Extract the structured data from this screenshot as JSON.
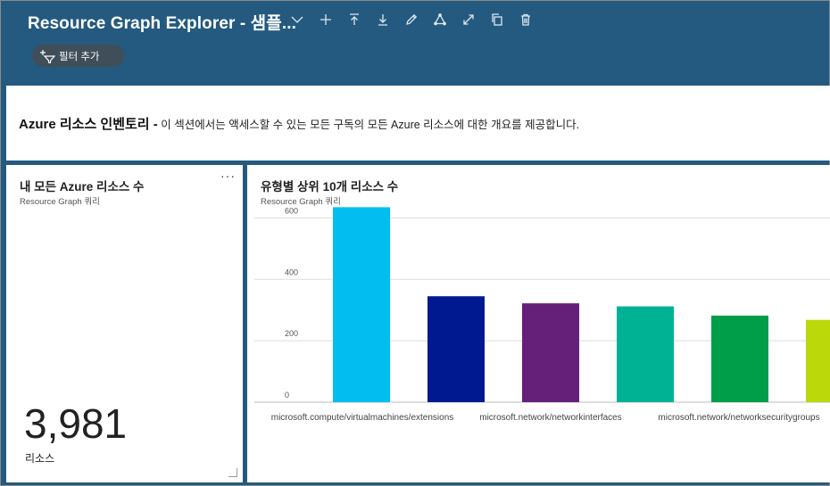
{
  "header": {
    "title": "Resource Graph Explorer - 샘플...",
    "filter_label": "필터 추가"
  },
  "markdown": {
    "bold": "Azure 리소스 인벤토리 -",
    "text": " 이 섹션에서는 액세스할 수 있는 모든 구독의 모든 Azure 리소스에 대한 개요를 제공합니다."
  },
  "tile_count": {
    "title": "내 모든 Azure 리소스 수",
    "subtitle": "Resource Graph 쿼리",
    "value": "3,981",
    "unit": "리소스",
    "more": "···"
  },
  "tile_chart": {
    "title": "유형별 상위 10개 리소스 수",
    "subtitle": "Resource Graph 쿼리"
  },
  "chart_data": {
    "type": "bar",
    "title": "유형별 상위 10개 리소스 수",
    "categories": [
      "microsoft.compute/virtualmachines/extensions",
      "microsoft.network/networkinterfaces",
      "microsoft.network/networksecuritygroups",
      "",
      "",
      ""
    ],
    "x_tick_labels": [
      "microsoft.compute/virtualmachines/extensions",
      "microsoft.network/networkinterfaces",
      "microsoft.network/networksecuritygroups"
    ],
    "values": [
      635,
      345,
      322,
      312,
      282,
      268
    ],
    "colors": [
      "#01bdf0",
      "#001990",
      "#652079",
      "#00b294",
      "#009e49",
      "#bad80a"
    ],
    "ylim": [
      0,
      700
    ],
    "yticks": [
      0,
      200,
      400,
      600
    ],
    "grid": true
  }
}
